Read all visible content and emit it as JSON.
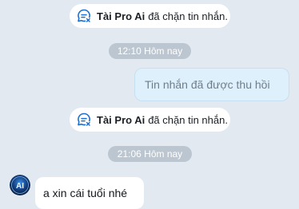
{
  "chat": {
    "notices": [
      {
        "name": "Tài Pro Ai",
        "text": "đã chặn tin nhắn.",
        "icon": "blocked-message-icon"
      },
      {
        "name": "Tài Pro Ai",
        "text": "đã chặn tin nhắn.",
        "icon": "blocked-message-icon"
      }
    ],
    "timestamps": [
      "12:10 Hôm nay",
      "21:06 Hôm nay"
    ],
    "outgoing_message": "Tin nhắn đã được thu hồi",
    "incoming_message": "a xin cái tuổi nhé",
    "avatar": {
      "label": "AI",
      "icon": "ai-avatar"
    }
  },
  "colors": {
    "background": "#e2e9f1",
    "notice_bg": "#ffffff",
    "time_pill_bg": "#bcc6d0",
    "outgoing_bg": "#def0fb",
    "recalled_text": "#6f7e8b",
    "icon_blue": "#1f6fd1"
  }
}
